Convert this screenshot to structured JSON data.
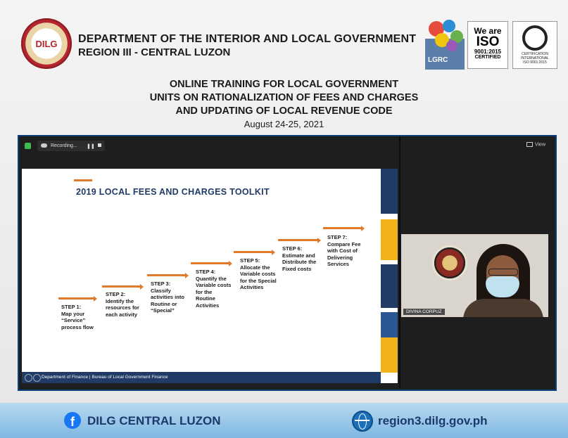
{
  "header": {
    "seal_text": "DILG",
    "department": "DEPARTMENT OF THE INTERIOR AND LOCAL GOVERNMENT",
    "region": "REGION III - CENTRAL LUZON",
    "lgrc_label": "LGRC",
    "iso": {
      "we_are": "We are",
      "iso": "ISO",
      "standard": "9001:2015",
      "certified": "CERTIFIED"
    },
    "cert": {
      "line1": "CERTIFICATION",
      "line2": "INTERNATIONAL",
      "line3": "ISO 9001:2015"
    }
  },
  "training": {
    "line1": "ONLINE TRAINING FOR LOCAL GOVERNMENT",
    "line2": "UNITS ON RATIONALIZATION OF FEES AND CHARGES",
    "line3": "AND UPDATING OF LOCAL REVENUE CODE",
    "date": "August 24-25, 2021"
  },
  "meeting": {
    "recording_label": "Recording...",
    "pause_glyph": "❚❚",
    "view_label": "View",
    "slide": {
      "title": "2019 LOCAL FEES AND CHARGES TOOLKIT",
      "steps": [
        {
          "label": "STEP 1:",
          "text": "Map your “Service” process flow"
        },
        {
          "label": "STEP 2:",
          "text": "Identify the resources for each activity"
        },
        {
          "label": "STEP 3:",
          "text": "Classify activities into Routine or “Special”"
        },
        {
          "label": "STEP 4:",
          "text": "Quantify the Variable costs for the Routine Activities"
        },
        {
          "label": "STEP 5:",
          "text": "Allocate the Variable costs for the Special Activities"
        },
        {
          "label": "STEP 6:",
          "text": "Estimate and Distribute the Fixed costs"
        },
        {
          "label": "STEP 7:",
          "text": "Compare Fee with Cost of Delivering Services"
        }
      ],
      "footer": "Department of Finance  |  Bureau of Local Government Finance"
    },
    "participant": {
      "name": "DIVINA CORPUZ"
    }
  },
  "footer": {
    "facebook_icon": "facebook-icon",
    "facebook_label": "DILG CENTRAL LUZON",
    "website_icon": "globe-icon",
    "website_label": "region3.dilg.gov.ph"
  },
  "colors": {
    "accent": "#e07a2a",
    "navy": "#1f3b66",
    "gold": "#f2b21a",
    "brand_blue": "#1877f2"
  }
}
